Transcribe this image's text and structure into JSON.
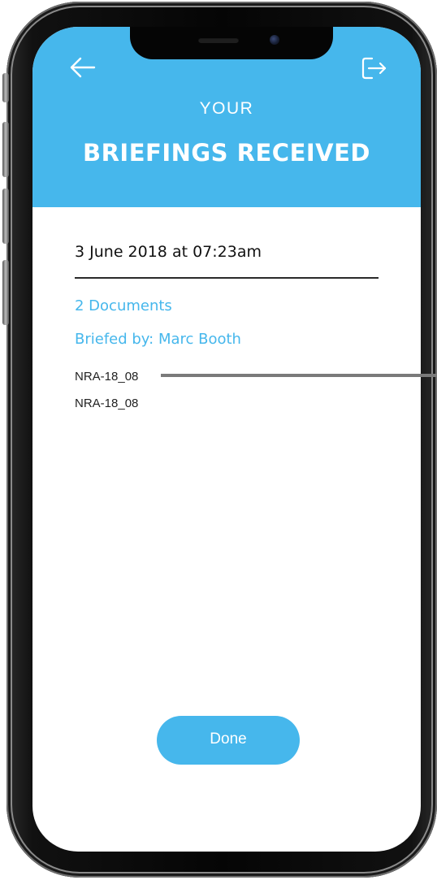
{
  "header": {
    "subtitle": "YOUR",
    "title": "BRIEFINGS RECEIVED",
    "back_icon": "arrow-left-icon",
    "logout_icon": "logout-icon"
  },
  "briefing": {
    "date": "3 June 2018 at 07:23am",
    "document_count": "2 Documents",
    "briefed_by": "Briefed by: Marc Booth",
    "documents": [
      {
        "name": "NRA-18_08"
      },
      {
        "name": "NRA-18_08"
      }
    ]
  },
  "actions": {
    "done_label": "Done"
  },
  "colors": {
    "accent": "#46b7ec",
    "text": "#111111",
    "background": "#ffffff"
  }
}
